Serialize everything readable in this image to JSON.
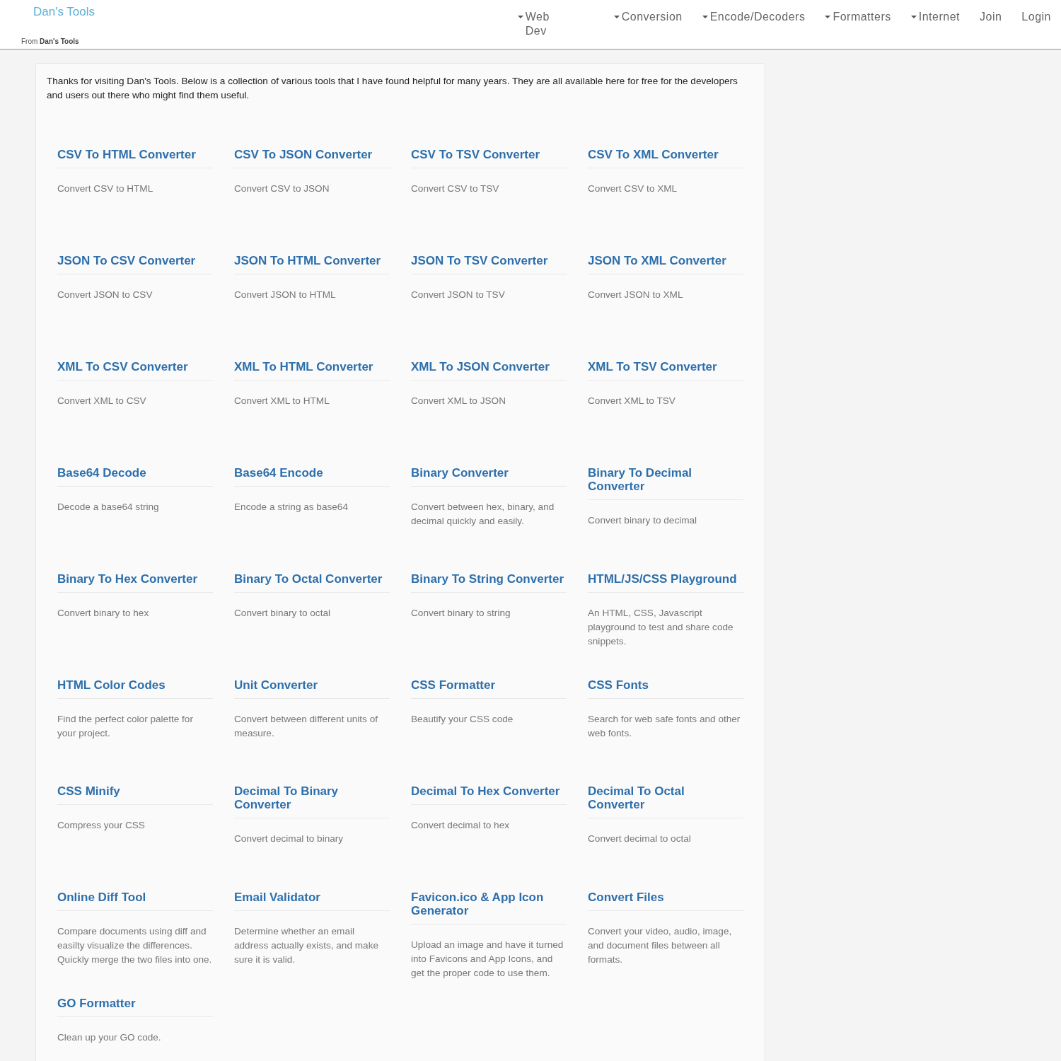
{
  "header": {
    "logo": "Dan's Tools",
    "tagline": "From **Dan's Tools**",
    "nav": [
      {
        "label": "Web Dev",
        "kind": "dropdown"
      },
      {
        "label": "Conversion",
        "kind": "dropdown"
      },
      {
        "label": "Encode/Decoders",
        "kind": "dropdown"
      },
      {
        "label": "Formatters",
        "kind": "dropdown"
      },
      {
        "label": "Internet",
        "kind": "dropdown"
      },
      {
        "label": "Join",
        "kind": "link"
      },
      {
        "label": "Login",
        "kind": "link"
      }
    ]
  },
  "intro": "Thanks for visiting Dan's Tools. Below is a collection of various tools that I have found helpful for many years. They are all available here for free for the developers and users out there who might find them useful.",
  "tools": [
    {
      "title": "CSV To HTML Converter",
      "description": "Convert CSV to HTML"
    },
    {
      "title": "CSV To JSON Converter",
      "description": "Convert CSV to JSON"
    },
    {
      "title": "CSV To TSV Converter",
      "description": "Convert CSV to TSV"
    },
    {
      "title": "CSV To XML Converter",
      "description": "Convert CSV to XML"
    },
    {
      "title": "JSON To CSV Converter",
      "description": "Convert JSON to CSV"
    },
    {
      "title": "JSON To HTML Converter",
      "description": "Convert JSON to HTML"
    },
    {
      "title": "JSON To TSV Converter",
      "description": "Convert JSON to TSV"
    },
    {
      "title": "JSON To XML Converter",
      "description": "Convert JSON to XML"
    },
    {
      "title": "XML To CSV Converter",
      "description": "Convert XML to CSV"
    },
    {
      "title": "XML To HTML Converter",
      "description": "Convert XML to HTML"
    },
    {
      "title": "XML To JSON Converter",
      "description": "Convert XML to JSON"
    },
    {
      "title": "XML To TSV Converter",
      "description": "Convert XML to TSV"
    },
    {
      "title": "Base64 Decode",
      "description": "Decode a base64 string"
    },
    {
      "title": "Base64 Encode",
      "description": "Encode a string as base64"
    },
    {
      "title": "Binary Converter",
      "description": "Convert between hex, binary, and decimal quickly and easily."
    },
    {
      "title": "Binary To Decimal Converter",
      "description": "Convert binary to decimal"
    },
    {
      "title": "Binary To Hex Converter",
      "description": "Convert binary to hex"
    },
    {
      "title": "Binary To Octal Converter",
      "description": "Convert binary to octal"
    },
    {
      "title": "Binary To String Converter",
      "description": "Convert binary to string"
    },
    {
      "title": "HTML/JS/CSS Playground",
      "description": "An HTML, CSS, Javascript playground to test and share code snippets."
    },
    {
      "title": "HTML Color Codes",
      "description": "Find the perfect color palette for your project."
    },
    {
      "title": "Unit Converter",
      "description": "Convert between different units of measure."
    },
    {
      "title": "CSS Formatter",
      "description": "Beautify your CSS code"
    },
    {
      "title": "CSS Fonts",
      "description": "Search for web safe fonts and other web fonts."
    },
    {
      "title": "CSS Minify",
      "description": "Compress your CSS"
    },
    {
      "title": "Decimal To Binary Converter",
      "description": "Convert decimal to binary"
    },
    {
      "title": "Decimal To Hex Converter",
      "description": "Convert decimal to hex"
    },
    {
      "title": "Decimal To Octal Converter",
      "description": "Convert decimal to octal"
    },
    {
      "title": "Online Diff Tool",
      "description": "Compare documents using diff and easilty visualize the differences. Quickly merge the two files into one."
    },
    {
      "title": "Email Validator",
      "description": "Determine whether an email address actually exists, and make sure it is valid."
    },
    {
      "title": "Favicon.ico & App Icon Generator",
      "description": "Upload an image and have it turned into Favicons and App Icons, and get the proper code to use them."
    },
    {
      "title": "Convert Files",
      "description": "Convert your video, audio, image, and document files between all formats."
    },
    {
      "title": "GO Formatter",
      "description": "Clean up your GO code."
    }
  ]
}
